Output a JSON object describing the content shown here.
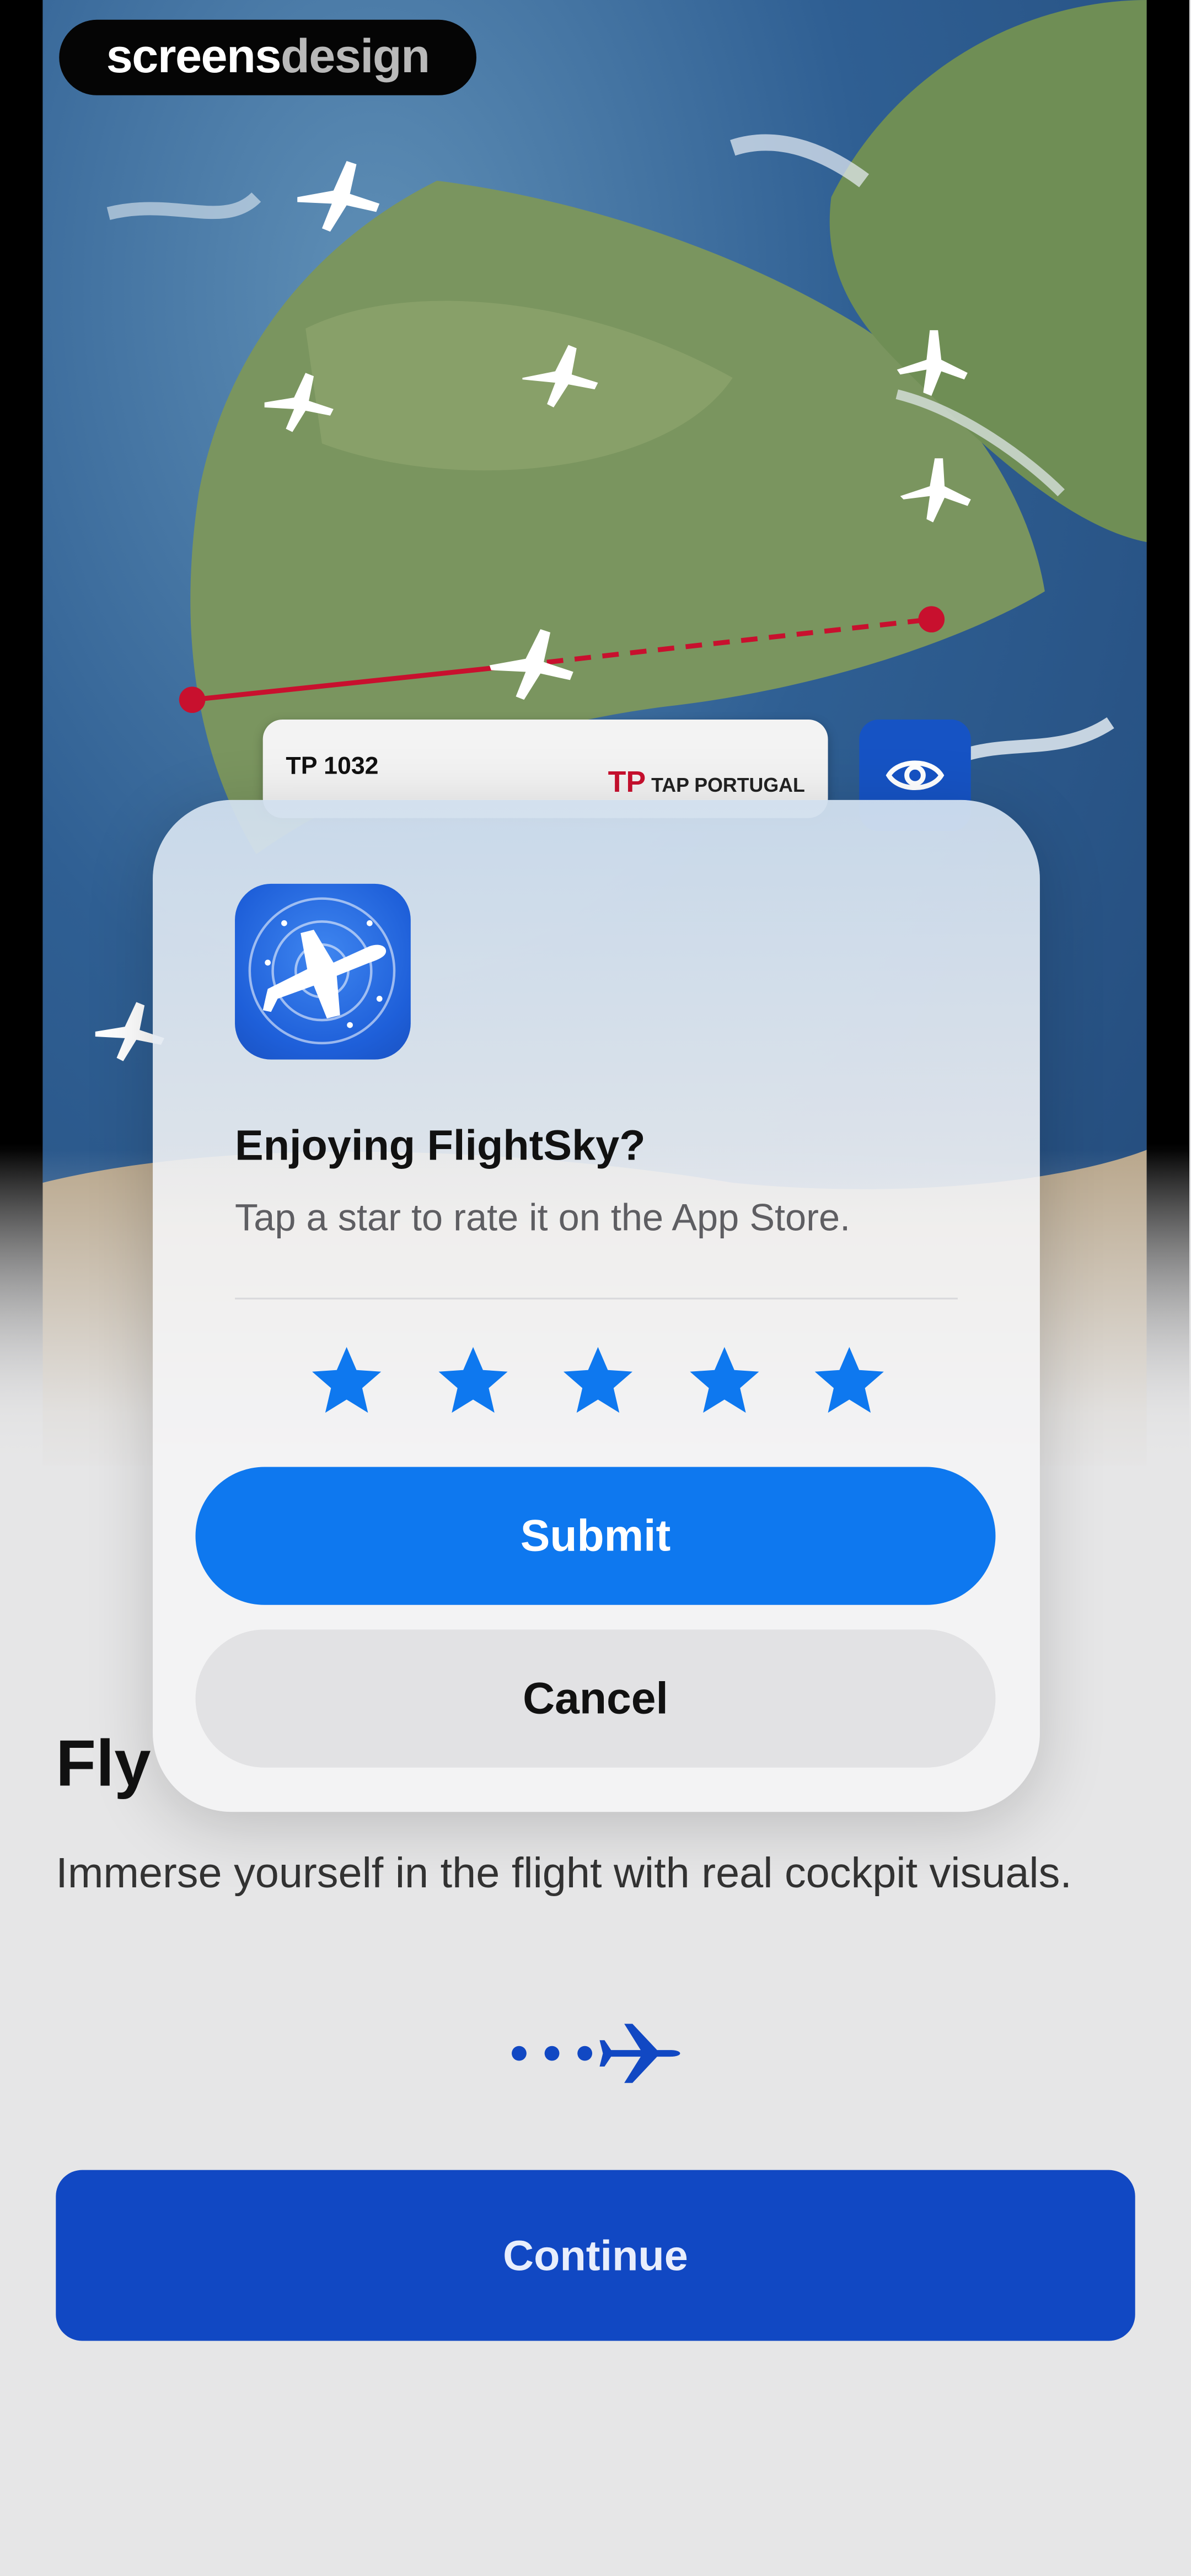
{
  "brand": {
    "logo_bold": "screens",
    "logo_light": "design"
  },
  "map": {
    "flight_card": {
      "flight_number": "TP 1032",
      "airline_mark": "TP",
      "airline_name": "TAP PORTUGAL"
    },
    "eye_icon": "eye-icon",
    "route_color": "#c8102e"
  },
  "dialog": {
    "title": "Enjoying FlightSky?",
    "message": "Tap a star to rate it on the App Store.",
    "stars": [
      "star",
      "star",
      "star",
      "star",
      "star"
    ],
    "star_color": "#0e78ef",
    "submit_label": "Submit",
    "cancel_label": "Cancel"
  },
  "onboarding": {
    "title": "Fly",
    "body": "Immerse yourself in the flight with real cockpit visuals.",
    "continue_label": "Continue",
    "accent": "#1148c3"
  }
}
